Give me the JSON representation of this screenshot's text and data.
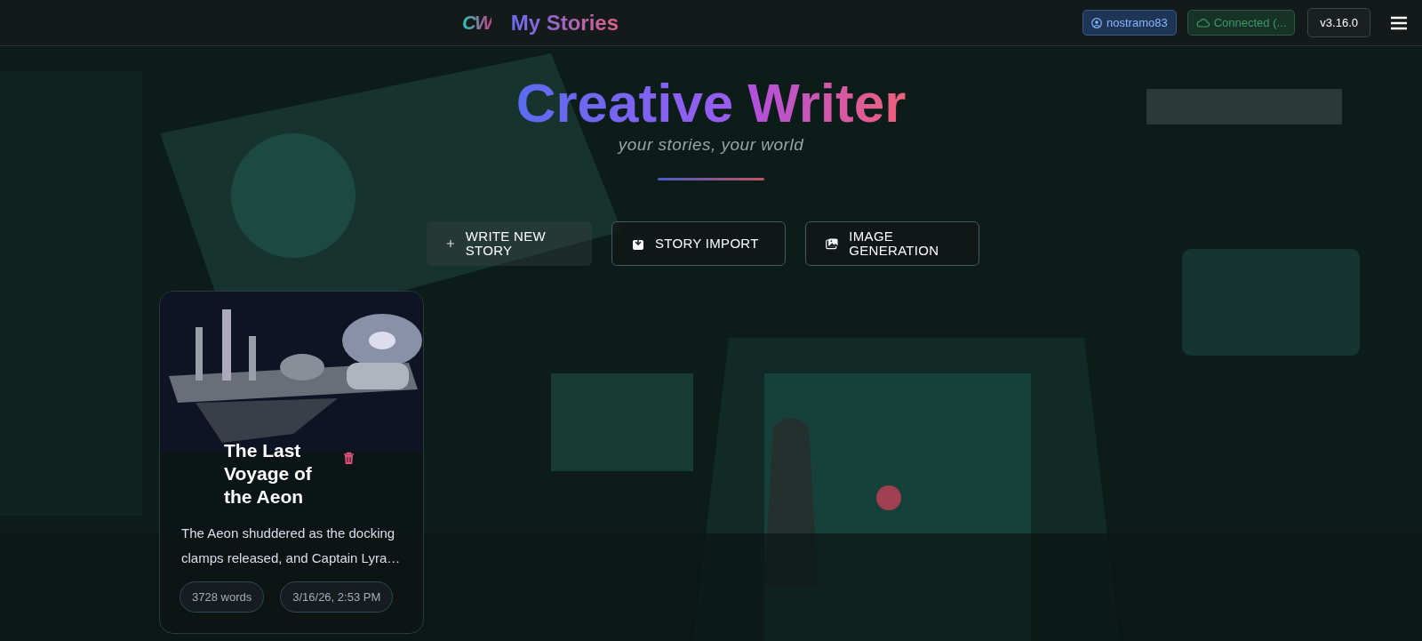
{
  "header": {
    "logo": "CW",
    "title": "My Stories",
    "user": "nostramo83",
    "connection": "Connected (...",
    "version": "v3.16.0"
  },
  "hero": {
    "title_parts": [
      "Creative",
      "Writer"
    ],
    "subtitle": "your stories, your world"
  },
  "actions": [
    {
      "label": "WRITE NEW STORY",
      "kind": "new"
    },
    {
      "label": "STORY IMPORT",
      "kind": "import"
    },
    {
      "label": "IMAGE GENERATION",
      "kind": "generate"
    }
  ],
  "stories": [
    {
      "title": "The Last Voyage of the Aeon",
      "excerpt": "The Aeon shuddered as the docking clamps released, and Captain Lyra…",
      "words": "3728 words",
      "date": "3/16/26, 2:53 PM"
    }
  ]
}
